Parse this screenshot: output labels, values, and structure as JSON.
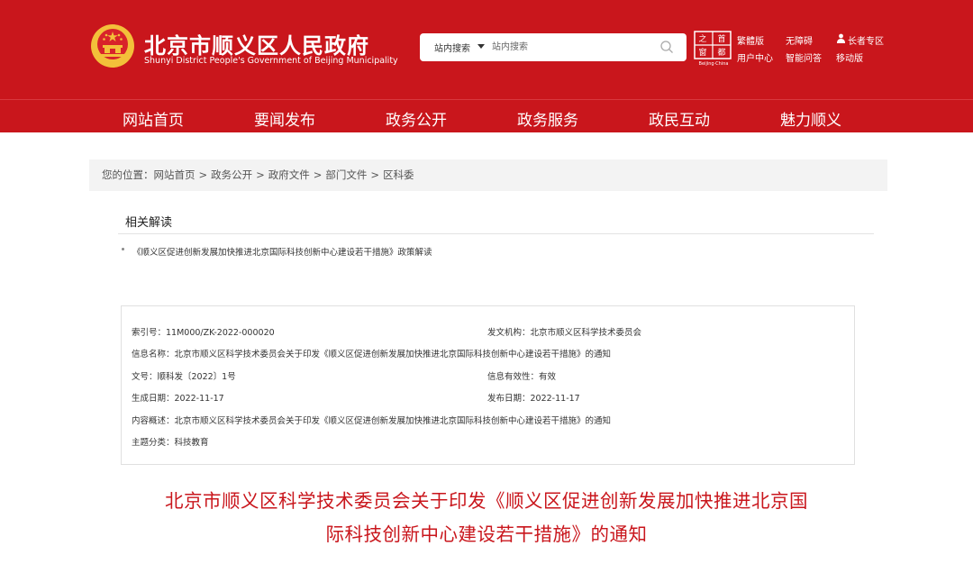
{
  "header": {
    "site_title": "北京市顺义区人民政府",
    "site_subtitle": "Shunyi District People's Government of Beijing Municipality",
    "search": {
      "scope": "站内搜索",
      "placeholder": "站内搜索"
    },
    "capital_logo_text": "Beijing·China",
    "capital_logo_chars": [
      "之",
      "首",
      "都",
      "窗"
    ],
    "links": {
      "traditional": "繁體版",
      "accessible": "无障碍",
      "elderly": "长者专区",
      "user_center": "用户中心",
      "smart_qa": "智能问答",
      "mobile": "移动版"
    }
  },
  "nav": {
    "items": [
      "网站首页",
      "要闻发布",
      "政务公开",
      "政务服务",
      "政民互动",
      "魅力顺义"
    ]
  },
  "breadcrumb": {
    "prefix": "您的位置：",
    "items": [
      "网站首页",
      "政务公开",
      "政府文件",
      "部门文件",
      "区科委"
    ],
    "separator": ">"
  },
  "related": {
    "title": "相关解读",
    "items": [
      "《顺义区促进创新发展加快推进北京国际科技创新中心建设若干措施》政策解读"
    ]
  },
  "info": {
    "index_no": "索引号：11M000/ZK-2022-000020",
    "issuer": "发文机构：北京市顺义区科学技术委员会",
    "name": "信息名称：北京市顺义区科学技术委员会关于印发《顺义区促进创新发展加快推进北京国际科技创新中心建设若干措施》的通知",
    "doc_no": "文号：顺科发〔2022〕1号",
    "validity": "信息有效性：有效",
    "created": "生成日期：2022-11-17",
    "published": "发布日期：2022-11-17",
    "summary": "内容概述：北京市顺义区科学技术委员会关于印发《顺义区促进创新发展加快推进北京国际科技创新中心建设若干措施》的通知",
    "category": "主题分类：科技教育"
  },
  "document": {
    "title_line1": "北京市顺义区科学技术委员会关于印发《顺义区促进创新发展加快推进北京国",
    "title_line2": "际科技创新中心建设若干措施》的通知"
  },
  "colors": {
    "brand_red": "#c9161c",
    "emblem_gold": "#f3c03a"
  }
}
